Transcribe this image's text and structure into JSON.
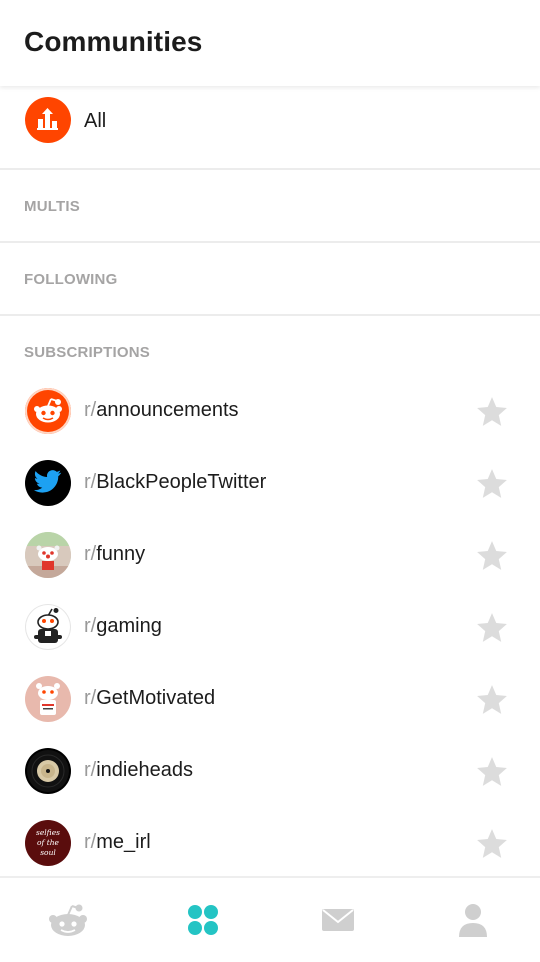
{
  "header": {
    "title": "Communities"
  },
  "all": {
    "label": "All"
  },
  "sections": {
    "multis": "MULTIS",
    "following": "FOLLOWING",
    "subscriptions": "SUBSCRIPTIONS"
  },
  "subreddit_prefix": "r/",
  "subscriptions": [
    {
      "name": "announcements",
      "icon": "reddit-alien-icon"
    },
    {
      "name": "BlackPeopleTwitter",
      "icon": "twitter-bird-icon"
    },
    {
      "name": "funny",
      "icon": "funny-icon"
    },
    {
      "name": "gaming",
      "icon": "gaming-icon"
    },
    {
      "name": "GetMotivated",
      "icon": "getmotivated-icon"
    },
    {
      "name": "indieheads",
      "icon": "vinyl-record-icon"
    },
    {
      "name": "me_irl",
      "icon": "me-irl-icon",
      "icon_text": "selfies of the soul"
    }
  ],
  "bottom_nav": [
    {
      "name": "home",
      "icon": "reddit-home-icon",
      "active": false
    },
    {
      "name": "communities",
      "icon": "communities-grid-icon",
      "active": true
    },
    {
      "name": "inbox",
      "icon": "mail-icon",
      "active": false
    },
    {
      "name": "account",
      "icon": "user-icon",
      "active": false
    }
  ],
  "colors": {
    "accent": "#ff4500",
    "active_nav": "#24c4c4",
    "inactive_nav": "#cfcfcf",
    "section_label": "#a5a4a4",
    "star": "#dcdcdc"
  }
}
